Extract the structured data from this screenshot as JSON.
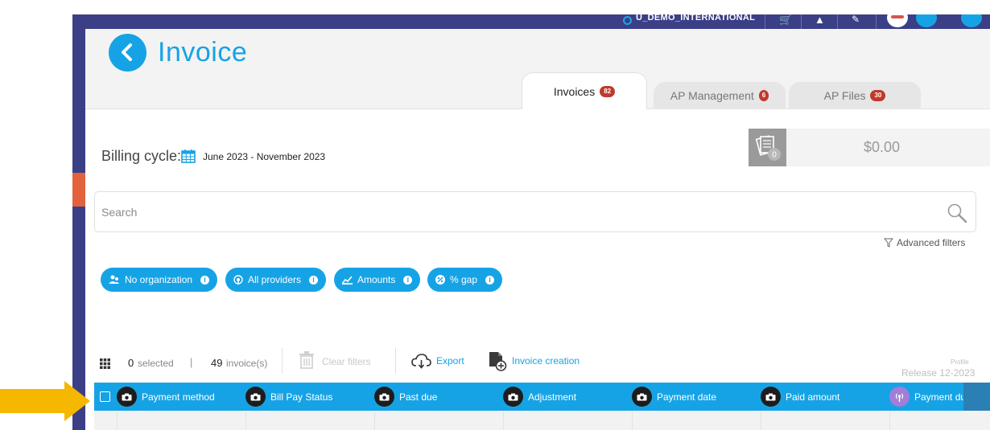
{
  "top_bar": {
    "org_name": "U_DEMO_INTERNATIONAL",
    "icons": [
      "cart-icon",
      "bell-icon",
      "wrench-icon",
      "avatar-icon",
      "help-icon"
    ]
  },
  "header": {
    "title": "Invoice",
    "back_icon": "chevron-left-icon"
  },
  "tabs": [
    {
      "label": "Invoices",
      "count": "82",
      "active": true
    },
    {
      "label": "AP Management",
      "count": "6",
      "active": false
    },
    {
      "label": "AP Files",
      "count": "30",
      "active": false
    }
  ],
  "billing": {
    "label": "Billing cycle:",
    "range": "June 2023 - November 2023"
  },
  "summary": {
    "stack_count": "0",
    "amount": "$0.00"
  },
  "search": {
    "placeholder": "Search"
  },
  "advanced_filters": "Advanced filters",
  "filters": [
    {
      "label": "No organization",
      "icon": "organization-icon"
    },
    {
      "label": "All providers",
      "icon": "provider-icon"
    },
    {
      "label": "Amounts",
      "icon": "amounts-icon"
    },
    {
      "label": "% gap",
      "icon": "percent-icon"
    }
  ],
  "toolbar": {
    "selected_count": "0",
    "selected_label": "selected",
    "separator": "|",
    "invoice_count": "49",
    "invoice_label": "invoice(s)",
    "clear_filters": "Clear filters",
    "export": "Export",
    "invoice_creation": "Invoice creation",
    "profile": "Profile",
    "release": "Release 12-2023"
  },
  "table": {
    "columns": [
      {
        "label": "Payment method",
        "icon": "camera-icon"
      },
      {
        "label": "Bill Pay Status",
        "icon": "camera-icon"
      },
      {
        "label": "Past due",
        "icon": "camera-icon"
      },
      {
        "label": "Adjustment",
        "icon": "camera-icon"
      },
      {
        "label": "Payment date",
        "icon": "camera-icon"
      },
      {
        "label": "Paid amount",
        "icon": "camera-icon"
      },
      {
        "label": "Payment due d",
        "icon": "antenna-icon"
      }
    ]
  },
  "colors": {
    "accent": "#16a3e6",
    "sidebar": "#3b3f86",
    "badge": "#c0392b",
    "arrow": "#f5b700"
  }
}
